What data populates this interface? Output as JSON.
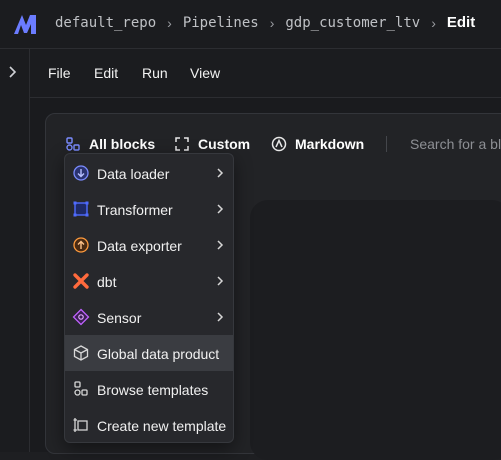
{
  "header": {
    "breadcrumbs": [
      "default_repo",
      "Pipelines",
      "gdp_customer_ltv"
    ],
    "current": "Edit"
  },
  "menubar": {
    "items": [
      "File",
      "Edit",
      "Run",
      "View"
    ]
  },
  "toolbar": {
    "all_blocks": "All blocks",
    "custom": "Custom",
    "markdown": "Markdown",
    "search_placeholder": "Search for a bl"
  },
  "dropdown": {
    "items": [
      {
        "label": "Data loader",
        "icon": "data-loader-icon",
        "submenu": true
      },
      {
        "label": "Transformer",
        "icon": "transformer-icon",
        "submenu": true
      },
      {
        "label": "Data exporter",
        "icon": "data-exporter-icon",
        "submenu": true
      },
      {
        "label": "dbt",
        "icon": "dbt-icon",
        "submenu": true
      },
      {
        "label": "Sensor",
        "icon": "sensor-icon",
        "submenu": true
      },
      {
        "label": "Global data product",
        "icon": "cube-icon",
        "submenu": false,
        "highlighted": true
      },
      {
        "label": "Browse templates",
        "icon": "templates-icon",
        "submenu": false
      },
      {
        "label": "Create new template",
        "icon": "new-template-icon",
        "submenu": false
      }
    ]
  },
  "colors": {
    "brand_blue": "#6b7cff",
    "data_loader": "#7b8cff",
    "transformer": "#4f6bff",
    "data_exporter": "#ff9b3d",
    "dbt": "#ff6a3d",
    "sensor": "#c061ff"
  }
}
